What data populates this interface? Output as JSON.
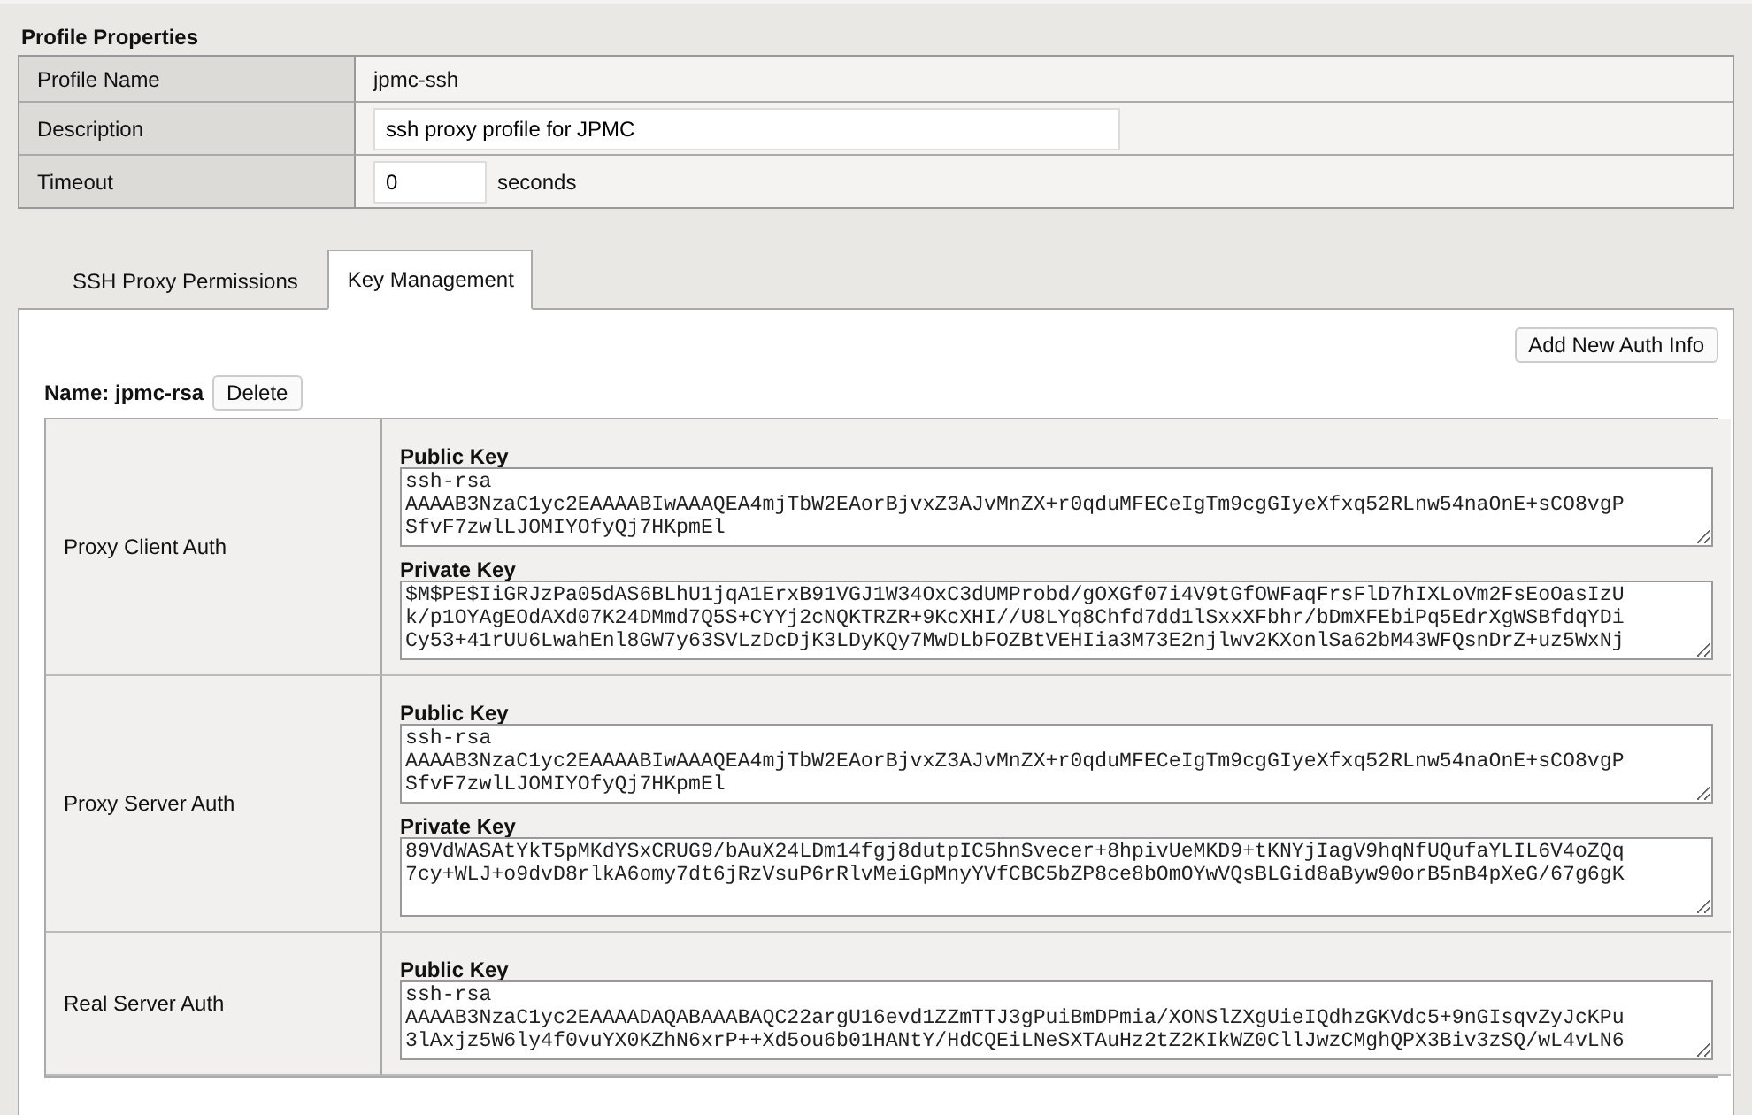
{
  "section_title": "Profile Properties",
  "properties": [
    {
      "kind": "text",
      "label": "Profile Name",
      "value": "jpmc-ssh"
    },
    {
      "kind": "field",
      "label": "Description",
      "value": "ssh proxy profile for JPMC"
    },
    {
      "kind": "number",
      "label": "Timeout",
      "value": "0",
      "unit": "seconds"
    }
  ],
  "tabs": [
    {
      "label": "SSH Proxy Permissions",
      "selected": false
    },
    {
      "label": "Key Management",
      "selected": true
    }
  ],
  "add_button": "Add New Auth Info",
  "key_name": {
    "label": "Name: jpmc-rsa",
    "delete_button": "Delete"
  },
  "auth_rows": [
    {
      "label": "Proxy Client Auth",
      "keys": [
        {
          "label": "Public Key",
          "value": "ssh-rsa\nAAAAB3NzaC1yc2EAAAABIwAAAQEA4mjTbW2EAorBjvxZ3AJvMnZX+r0qduMFECeIgTm9cgGIyeXfxq52RLnw54naOnE+sCO8vgP\nSfvF7zwlLJOMIYOfyQj7HKpmEl"
        },
        {
          "label": "Private Key",
          "value": "$M$PE$IiGRJzPa05dAS6BLhU1jqA1ErxB91VGJ1W34OxC3dUMProbd/gOXGf07i4V9tGfOWFaqFrsFlD7hIXLoVm2FsEoOasIzU\nk/p1OYAgEOdAXd07K24DMmd7Q5S+CYYj2cNQKTRZR+9KcXHI//U8LYq8Chfd7dd1lSxxXFbhr/bDmXFEbiPq5EdrXgWSBfdqYDi\nCy53+41rUU6LwahEnl8GW7y63SVLzDcDjK3LDyKQy7MwDLbFOZBtVEHIia3M73E2njlwv2KXonlSa62bM43WFQsnDrZ+uz5WxNj"
        }
      ]
    },
    {
      "label": "Proxy Server Auth",
      "keys": [
        {
          "label": "Public Key",
          "value": "ssh-rsa\nAAAAB3NzaC1yc2EAAAABIwAAAQEA4mjTbW2EAorBjvxZ3AJvMnZX+r0qduMFECeIgTm9cgGIyeXfxq52RLnw54naOnE+sCO8vgP\nSfvF7zwlLJOMIYOfyQj7HKpmEl"
        },
        {
          "label": "Private Key",
          "value": "89VdWASAtYkT5pMKdYSxCRUG9/bAuX24LDm14fgj8dutpIC5hnSvecer+8hpivUeMKD9+tKNYjIagV9hqNfUQufaYLIL6V4oZQq\n7cy+WLJ+o9dvD8rlkA6omy7dt6jRzVsuP6rRlvMeiGpMnyYVfCBC5bZP8ce8bOmOYwVQsBLGid8aByw90orB5nB4pXeG/67g6gK"
        }
      ]
    },
    {
      "label": "Real Server Auth",
      "keys": [
        {
          "label": "Public Key",
          "value": "ssh-rsa\nAAAAB3NzaC1yc2EAAAADAQABAAABAQC22argU16evd1ZZmTTJ3gPuiBmDPmia/XONSlZXgUieIQdhzGKVdc5+9nGIsqvZyJcKPu\n3lAxjz5W6ly4f0vuYX0KZhN6xrP++Xd5ou6b01HANtY/HdCQEiLNeSXTAuHz2tZ2KIkWZ0CllJwzCMghQPX3Biv3zSQ/wL4vLN6"
        }
      ]
    }
  ]
}
